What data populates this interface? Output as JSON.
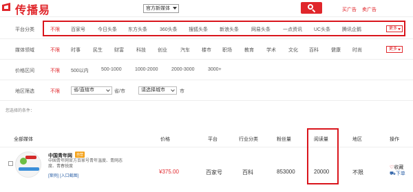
{
  "header": {
    "logo_text": "传播易",
    "search_select": "官方新媒体",
    "links": [
      "买广告",
      "卖广告"
    ]
  },
  "filters": {
    "platform": {
      "label": "平台分类",
      "options": [
        "不限",
        "百家号",
        "今日头条",
        "东方头条",
        "360头条",
        "搜狐头条",
        "新浪头条",
        "网易头条",
        "一点资讯",
        "UC头条",
        "腾讯企鹅"
      ],
      "more": "更多"
    },
    "field": {
      "label": "媒体领域",
      "options": [
        "不限",
        "时事",
        "民生",
        "财富",
        "科技",
        "创业",
        "汽车",
        "楼市",
        "职场",
        "教育",
        "学术",
        "文化",
        "百科",
        "健康",
        "时尚"
      ],
      "more": "更多"
    },
    "price": {
      "label": "价格区间",
      "options": [
        "不限",
        "500以内",
        "500-1000",
        "1000-2000",
        "2000-3000",
        "3000+"
      ]
    },
    "region": {
      "label": "地区筛选",
      "first_option": "不限",
      "province_select": "省/直辖市",
      "province_unit": "省/市",
      "city_select": "请选择城市",
      "city_unit": "市"
    },
    "selected_label": "您选择的条件："
  },
  "table": {
    "headers": {
      "all_media": "全部媒体",
      "price": "价格",
      "platform": "平台",
      "industry": "行业分类",
      "fans": "粉丝量",
      "reads": "阅读量",
      "region": "地区",
      "action": "操作"
    },
    "rows": [
      {
        "name": "中国青年网",
        "tag": "自营",
        "description": "中国青年网官方百家号青年温度、青网态度、青春锐度",
        "links": "[案例]  [入口截图]",
        "price": "¥375.00",
        "platform": "百家号",
        "industry": "百科",
        "fans": "853000",
        "reads": "20000",
        "region": "不限",
        "collect": "收藏",
        "order": "下单"
      }
    ]
  },
  "colors": {
    "brand_red": "#e0262b",
    "annotation_red": "#d9141b",
    "link_blue": "#3366aa"
  }
}
